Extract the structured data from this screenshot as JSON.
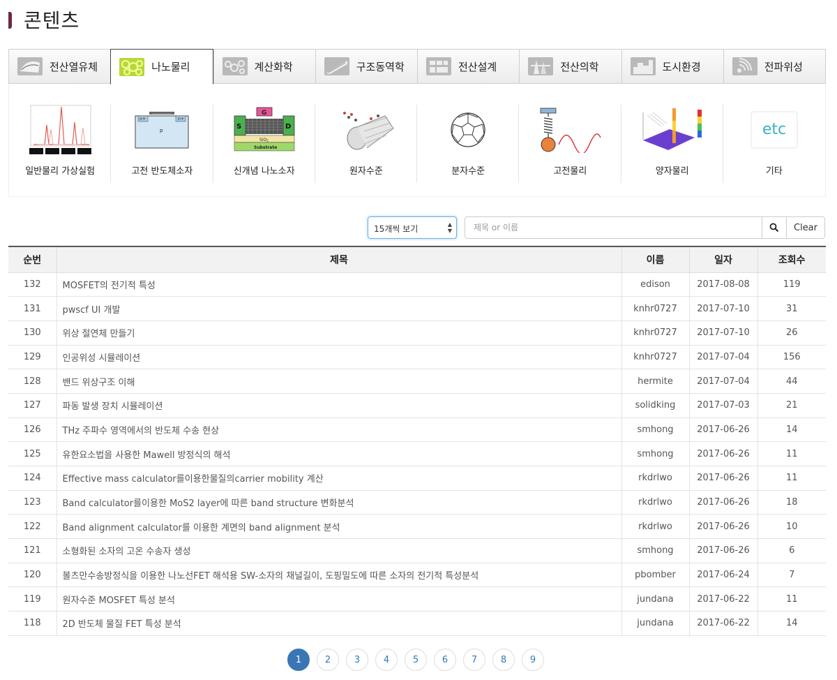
{
  "page": {
    "title": "콘텐츠"
  },
  "tabs": [
    {
      "label": "전산열유체",
      "icon": "fluid-icon",
      "active": false
    },
    {
      "label": "나노물리",
      "icon": "nano-icon",
      "active": true
    },
    {
      "label": "계산화학",
      "icon": "chemistry-icon",
      "active": false
    },
    {
      "label": "구조동역학",
      "icon": "structure-icon",
      "active": false
    },
    {
      "label": "전산설계",
      "icon": "design-icon",
      "active": false
    },
    {
      "label": "전산의학",
      "icon": "medical-icon",
      "active": false
    },
    {
      "label": "도시환경",
      "icon": "city-icon",
      "active": false
    },
    {
      "label": "전파위성",
      "icon": "radio-icon",
      "active": false
    }
  ],
  "subcategories": [
    {
      "label": "일반물리 가상실험",
      "icon": "spectrum-graph-icon"
    },
    {
      "label": "고전 반도체소자",
      "icon": "semiconductor-icon",
      "text_a": "n+",
      "text_b": "p",
      "text_c": "n+"
    },
    {
      "label": "신개념 나노소자",
      "icon": "nanotube-transistor-icon",
      "text_g": "G",
      "text_s": "S",
      "text_d": "D",
      "text_sio": "SiO",
      "text_sio_sub": "2",
      "text_substrate": "Substrate"
    },
    {
      "label": "원자수준",
      "icon": "atomic-tube-icon"
    },
    {
      "label": "분자수준",
      "icon": "fullerene-icon"
    },
    {
      "label": "고전물리",
      "icon": "spring-wave-icon"
    },
    {
      "label": "양자물리",
      "icon": "quantum-plot-icon"
    },
    {
      "label": "기타",
      "icon": "etc-icon",
      "text": "etc"
    }
  ],
  "controls": {
    "page_size_value": "15개씩 보기",
    "page_size_arrows": "▲▼",
    "search_placeholder": "제목 or 이름",
    "clear_label": "Clear"
  },
  "table": {
    "headers": {
      "no": "순번",
      "title": "제목",
      "name": "이름",
      "date": "일자",
      "views": "조회수"
    },
    "rows": [
      {
        "no": "132",
        "title": "MOSFET의 전기적 특성",
        "name": "edison",
        "date": "2017-08-08",
        "views": "119"
      },
      {
        "no": "131",
        "title": "pwscf UI 개발",
        "name": "knhr0727",
        "date": "2017-07-10",
        "views": "31"
      },
      {
        "no": "130",
        "title": "위상 절연체 만들기",
        "name": "knhr0727",
        "date": "2017-07-10",
        "views": "26"
      },
      {
        "no": "129",
        "title": "인공위성 시뮬레이션",
        "name": "knhr0727",
        "date": "2017-07-04",
        "views": "156"
      },
      {
        "no": "128",
        "title": "밴드 위상구조 이해",
        "name": "hermite",
        "date": "2017-07-04",
        "views": "44"
      },
      {
        "no": "127",
        "title": "파동 발생 장치 시뮬레이션",
        "name": "solidking",
        "date": "2017-07-03",
        "views": "21"
      },
      {
        "no": "126",
        "title": "THz 주파수 영역에서의 반도체 수송 현상",
        "name": "smhong",
        "date": "2017-06-26",
        "views": "14"
      },
      {
        "no": "125",
        "title": "유한요소법을 사용한 Mawell 방정식의 해석",
        "name": "smhong",
        "date": "2017-06-26",
        "views": "11"
      },
      {
        "no": "124",
        "title": "Effective mass calculator를이용한물질의carrier mobility 계산",
        "name": "rkdrlwo",
        "date": "2017-06-26",
        "views": "11"
      },
      {
        "no": "123",
        "title": "Band calculator를이용한 MoS2 layer에 따른 band structure 변화분석",
        "name": "rkdrlwo",
        "date": "2017-06-26",
        "views": "18"
      },
      {
        "no": "122",
        "title": "Band alignment calculator를 이용한 계면의 band alignment 분석",
        "name": "rkdrlwo",
        "date": "2017-06-26",
        "views": "10"
      },
      {
        "no": "121",
        "title": "소형화된 소자의 고온 수송자 생성",
        "name": "smhong",
        "date": "2017-06-26",
        "views": "6"
      },
      {
        "no": "120",
        "title": "볼츠만수송방정식을 이용한 나노선FET 해석용 SW-소자의 채널길이, 도핑밀도에 따른 소자의 전기적 특성분석",
        "name": "pbomber",
        "date": "2017-06-24",
        "views": "7"
      },
      {
        "no": "119",
        "title": "원자수준 MOSFET 특성 분석",
        "name": "jundana",
        "date": "2017-06-22",
        "views": "11"
      },
      {
        "no": "118",
        "title": "2D 반도체 물질 FET 특성 분석",
        "name": "jundana",
        "date": "2017-06-22",
        "views": "14"
      }
    ]
  },
  "pagination": {
    "pages": [
      "1",
      "2",
      "3",
      "4",
      "5",
      "6",
      "7",
      "8",
      "9"
    ],
    "current": "1"
  },
  "colors": {
    "accent": "#3a76b5",
    "title_mark": "#6b2b3c",
    "etc_teal": "#38b3c2"
  }
}
